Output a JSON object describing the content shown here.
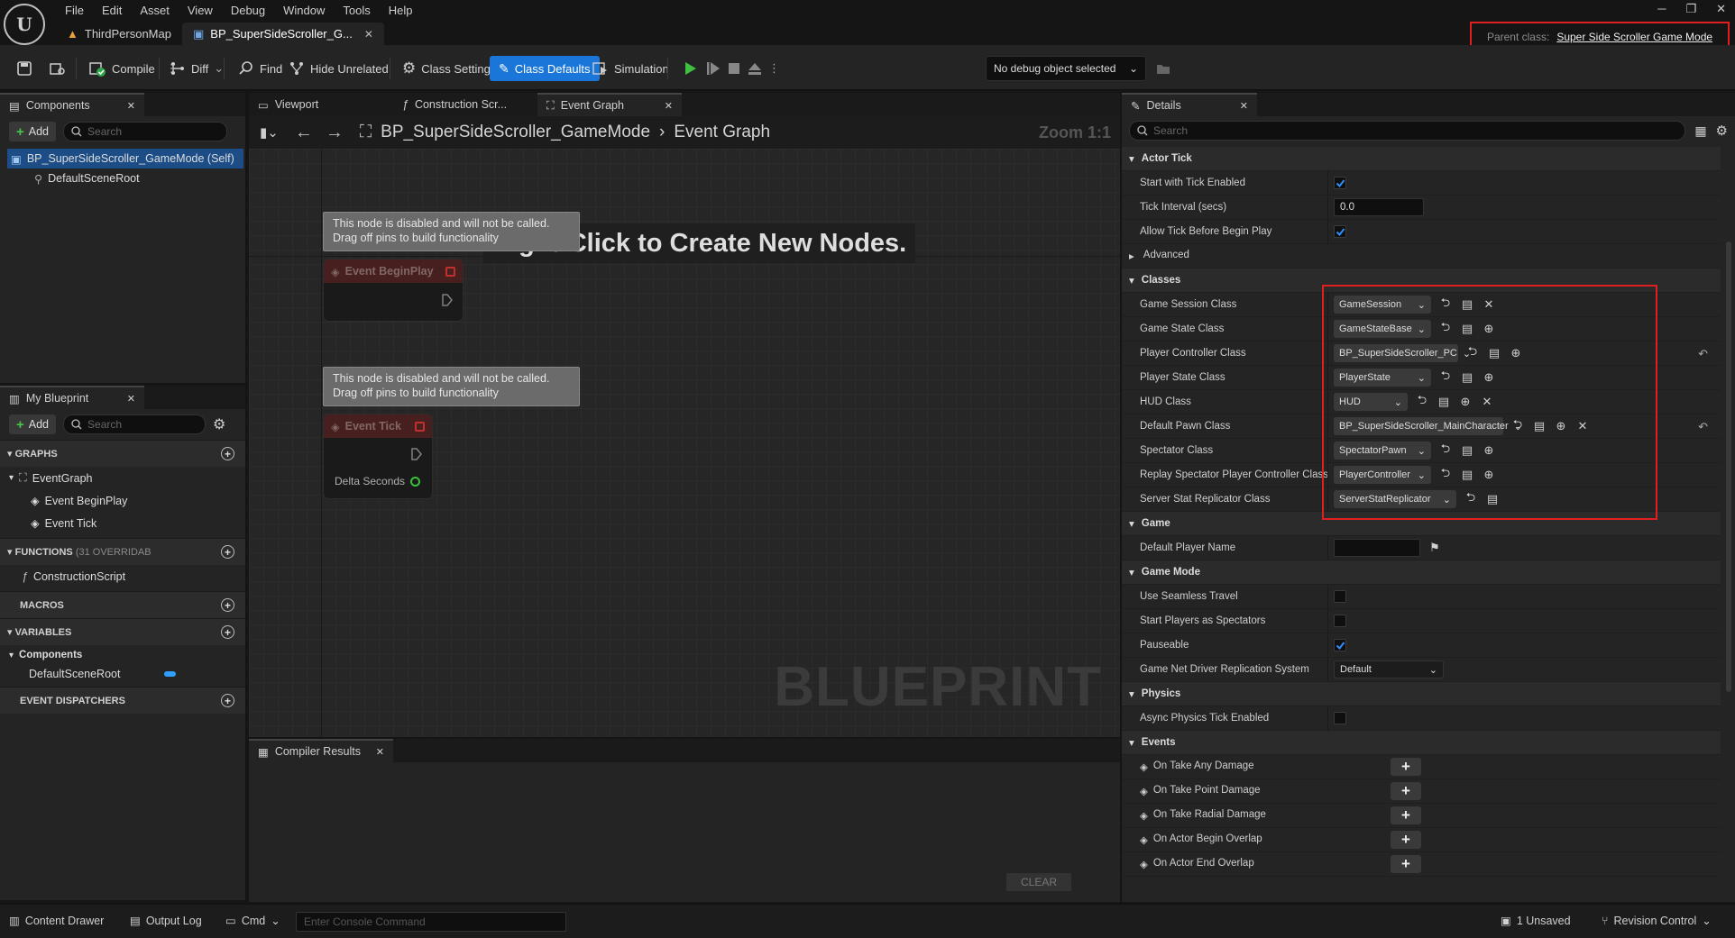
{
  "menu": [
    "File",
    "Edit",
    "Asset",
    "View",
    "Debug",
    "Window",
    "Tools",
    "Help"
  ],
  "doc_tabs": {
    "map": "ThirdPersonMap",
    "blueprint": "BP_SuperSideScroller_G..."
  },
  "parent_class": {
    "label": "Parent class:",
    "value": "Super Side Scroller Game Mode"
  },
  "toolbar": {
    "compile": "Compile",
    "diff": "Diff",
    "find": "Find",
    "hide_unrelated": "Hide Unrelated",
    "class_settings": "Class Settings",
    "class_defaults": "Class Defaults",
    "simulation": "Simulation",
    "debug_object": "No debug object selected"
  },
  "components": {
    "tab": "Components",
    "add": "Add",
    "search_placeholder": "Search",
    "root": "BP_SuperSideScroller_GameMode (Self)",
    "child": "DefaultSceneRoot"
  },
  "myblueprint": {
    "tab": "My Blueprint",
    "add": "Add",
    "search_placeholder": "Search",
    "graphs": "GRAPHS",
    "event_graph": "EventGraph",
    "event_beginplay": "Event BeginPlay",
    "event_tick": "Event Tick",
    "functions": "FUNCTIONS",
    "functions_count": "(31 OVERRIDAB",
    "construction_script": "ConstructionScript",
    "macros": "MACROS",
    "variables": "VARIABLES",
    "components_cat": "Components",
    "default_scene_root": "DefaultSceneRoot",
    "event_dispatchers": "EVENT DISPATCHERS"
  },
  "graph": {
    "tabs": [
      "Viewport",
      "Construction Scr...",
      "Event Graph"
    ],
    "crumb_root": "BP_SuperSideScroller_GameMode",
    "crumb_leaf": "Event Graph",
    "zoom": "Zoom 1:1",
    "hint": "Right-Click to Create New Nodes.",
    "watermark": "BLUEPRINT",
    "note_line1": "This node is disabled and will not be called.",
    "note_line2": "Drag off pins to build functionality",
    "node_beginplay": "Event BeginPlay",
    "node_tick": "Event Tick",
    "delta_seconds": "Delta Seconds"
  },
  "compiler": {
    "tab": "Compiler Results",
    "clear": "CLEAR"
  },
  "details": {
    "tab": "Details",
    "search_placeholder": "Search",
    "actor_tick": "Actor Tick",
    "start_with_tick": "Start with Tick Enabled",
    "tick_interval": "Tick Interval (secs)",
    "tick_interval_value": "0.0",
    "allow_tick": "Allow Tick Before Begin Play",
    "advanced": "Advanced",
    "classes": "Classes",
    "class_rows": [
      {
        "name": "Game Session Class",
        "value": "GameSession"
      },
      {
        "name": "Game State Class",
        "value": "GameStateBase"
      },
      {
        "name": "Player Controller Class",
        "value": "BP_SuperSideScroller_PC"
      },
      {
        "name": "Player State Class",
        "value": "PlayerState"
      },
      {
        "name": "HUD Class",
        "value": "HUD"
      },
      {
        "name": "Default Pawn Class",
        "value": "BP_SuperSideScroller_MainCharacter"
      },
      {
        "name": "Spectator Class",
        "value": "SpectatorPawn"
      },
      {
        "name": "Replay Spectator Player Controller Class",
        "value": "PlayerController"
      },
      {
        "name": "Server Stat Replicator Class",
        "value": "ServerStatReplicator"
      }
    ],
    "game": "Game",
    "default_player_name": "Default Player Name",
    "game_mode": "Game Mode",
    "use_seamless_travel": "Use Seamless Travel",
    "start_players_spectators": "Start Players as Spectators",
    "pauseable": "Pauseable",
    "net_driver": "Game Net Driver Replication System",
    "net_driver_value": "Default",
    "physics": "Physics",
    "async_physics": "Async Physics Tick Enabled",
    "events": "Events",
    "event_rows": [
      "On Take Any Damage",
      "On Take Point Damage",
      "On Take Radial Damage",
      "On Actor Begin Overlap",
      "On Actor End Overlap"
    ]
  },
  "statusbar": {
    "content_drawer": "Content Drawer",
    "output_log": "Output Log",
    "cmd": "Cmd",
    "console_placeholder": "Enter Console Command",
    "unsaved": "1 Unsaved",
    "revision_control": "Revision Control"
  },
  "colors": {
    "accent_blue": "#1a76d8",
    "highlight_red": "#e02020",
    "check_blue": "#2f8fff"
  }
}
